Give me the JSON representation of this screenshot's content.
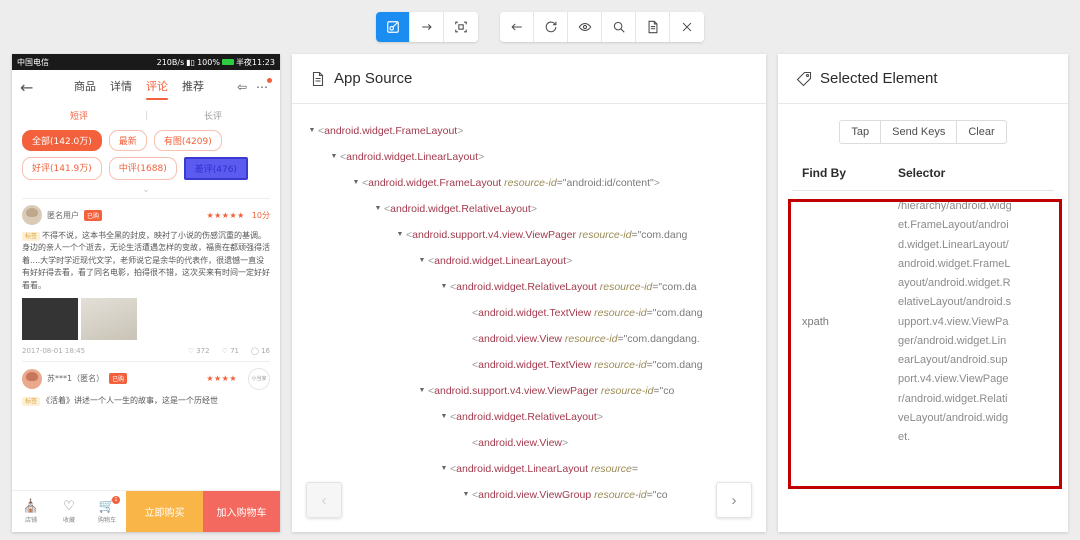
{
  "toolbar": {
    "groups": [
      {
        "buttons": [
          {
            "name": "select-element-button",
            "icon": "select-icon",
            "active": true
          },
          {
            "name": "swipe-button",
            "icon": "arrow-right-icon",
            "active": false
          },
          {
            "name": "tap-by-coordinates-button",
            "icon": "crosshair-icon",
            "active": false
          }
        ]
      },
      {
        "buttons": [
          {
            "name": "back-button",
            "icon": "arrow-left-icon",
            "active": false
          },
          {
            "name": "refresh-button",
            "icon": "refresh-icon",
            "active": false
          },
          {
            "name": "eye-button",
            "icon": "eye-icon",
            "active": false
          },
          {
            "name": "search-button",
            "icon": "search-icon",
            "active": false
          },
          {
            "name": "copy-source-button",
            "icon": "document-icon",
            "active": false
          },
          {
            "name": "close-button",
            "icon": "close-icon",
            "active": false
          }
        ]
      }
    ]
  },
  "phone": {
    "status_bar": {
      "carrier": "中国电信",
      "speed": "210B/s",
      "battery": "100%",
      "time": "半夜11:23"
    },
    "nav": {
      "back": "←",
      "tabs": [
        {
          "label": "商品",
          "selected": false
        },
        {
          "label": "详情",
          "selected": false
        },
        {
          "label": "评论",
          "selected": true
        },
        {
          "label": "推荐",
          "selected": false
        }
      ],
      "share_icon": "share-icon",
      "more_icon": "more-icon"
    },
    "subtabs": [
      {
        "label": "短评",
        "selected": true
      },
      {
        "label": "长评",
        "selected": false
      }
    ],
    "chips_row1": [
      {
        "label": "全部(142.0万)",
        "style": "full"
      },
      {
        "label": "最新",
        "style": "plain"
      },
      {
        "label": "有图(4209)",
        "style": "plain"
      }
    ],
    "chips_row2": [
      {
        "label": "好评(141.9万)",
        "style": "plain"
      },
      {
        "label": "中评(1688)",
        "style": "plain"
      },
      {
        "label": "差评(476)",
        "style": "picked"
      }
    ],
    "expand_chevron": "⌄",
    "review1": {
      "user": "匿名用户",
      "badge": "已购",
      "stars": "★★★★★",
      "score": "10分",
      "tag": "标签",
      "text": "不得不说，这本书全黑的封皮，映衬了小说的伤感沉重的基调。身边的亲人一个个逝去，无论生活遭遇怎样的变故，福贵在都顽强得活着....大学时学近现代文学，老师说它是余华的代表作，很遗憾一直没有好好得去看，看了同名电影，拍得很不错，这次买来有时间一定好好看看。",
      "date": "2017-08-01 18:45",
      "likes": "372",
      "comments": "71",
      "replies": "16"
    },
    "review2": {
      "user": "苏***1（匿名）",
      "badge": "已购",
      "stars": "★★★★",
      "circle_badge": "小当家",
      "text": "《活着》讲述一个人一生的故事，这是一个历经世"
    },
    "bottom": {
      "icons": [
        {
          "label": "店铺",
          "glyph": "⌂",
          "name": "shop-icon"
        },
        {
          "label": "收藏",
          "glyph": "♡",
          "name": "favorite-icon"
        },
        {
          "label": "购物车",
          "glyph": "🛒",
          "name": "cart-icon",
          "badge": "1"
        }
      ],
      "buy_now": "立即购买",
      "add_to_cart": "加入购物车"
    }
  },
  "app_source": {
    "title": "App Source",
    "icon": "document-icon",
    "tree": [
      {
        "indent": 0,
        "caret": true,
        "tag": "android.widget.FrameLayout",
        "attr": "",
        "val": ""
      },
      {
        "indent": 1,
        "caret": true,
        "tag": "android.widget.LinearLayout",
        "attr": "",
        "val": ""
      },
      {
        "indent": 2,
        "caret": true,
        "tag": "android.widget.FrameLayout",
        "attr": "resource-id",
        "val": "\"android:id/content\""
      },
      {
        "indent": 3,
        "caret": true,
        "tag": "android.widget.RelativeLayout",
        "attr": "",
        "val": ""
      },
      {
        "indent": 4,
        "caret": true,
        "tag": "android.support.v4.view.ViewPager",
        "attr": "resource-id",
        "val": "\"com.dang"
      },
      {
        "indent": 5,
        "caret": true,
        "tag": "android.widget.LinearLayout",
        "attr": "",
        "val": ""
      },
      {
        "indent": 6,
        "caret": true,
        "tag": "android.widget.RelativeLayout",
        "attr": "resource-id",
        "val": "\"com.da"
      },
      {
        "indent": 7,
        "caret": false,
        "tag": "android.widget.TextView",
        "attr": "resource-id",
        "val": "\"com.dang"
      },
      {
        "indent": 7,
        "caret": false,
        "tag": "android.view.View",
        "attr": "resource-id",
        "val": "\"com.dangdang."
      },
      {
        "indent": 7,
        "caret": false,
        "tag": "android.widget.TextView",
        "attr": "resource-id",
        "val": "\"com.dang"
      },
      {
        "indent": 5,
        "caret": true,
        "tag": "android.support.v4.view.ViewPager",
        "attr": "resource-id",
        "val": "\"co"
      },
      {
        "indent": 6,
        "caret": true,
        "tag": "android.widget.RelativeLayout",
        "attr": "",
        "val": ""
      },
      {
        "indent": 7,
        "caret": false,
        "tag": "android.view.View",
        "attr": "",
        "val": ""
      },
      {
        "indent": 6,
        "caret": true,
        "tag": "android.widget.LinearLayout",
        "attr": "resource",
        "val": ""
      },
      {
        "indent": 7,
        "caret": true,
        "tag": "android.view.ViewGroup",
        "attr": "resource-id",
        "val": "\"co"
      }
    ],
    "prev_label": "‹",
    "next_label": "›"
  },
  "selected_element": {
    "title": "Selected Element",
    "icon": "tag-icon",
    "actions": [
      "Tap",
      "Send Keys",
      "Clear"
    ],
    "table": {
      "headers": [
        "Find By",
        "Selector"
      ],
      "rows": [
        {
          "find_by": "xpath",
          "selector": "/hierarchy/android.widget.FrameLayout/android.widget.LinearLayout/android.widget.FrameLayout/android.widget.RelativeLayout/android.support.v4.view.ViewPager/android.widget.LinearLayout/android.support.v4.view.ViewPager/android.widget.RelativeLayout/android.widget."
        }
      ]
    },
    "highlight_color": "#c00000"
  }
}
